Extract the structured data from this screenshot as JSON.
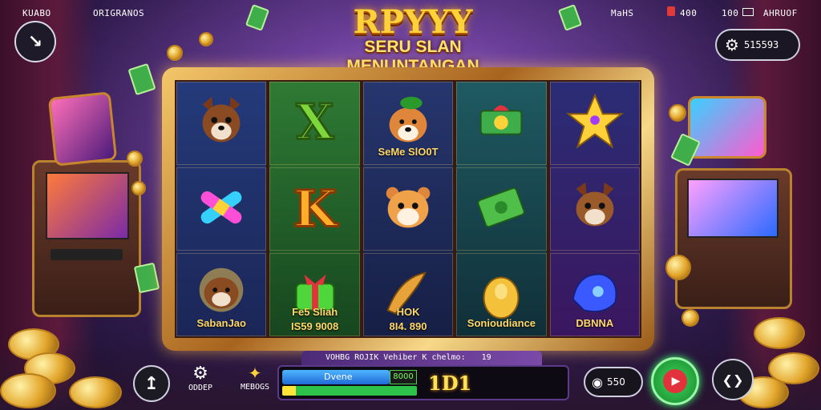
{
  "top": {
    "left_label_1": "KUABO",
    "left_label_2": "ORIGRANOS",
    "right_status_1": "MaHS",
    "right_status_2": "400",
    "right_status_3": "100",
    "right_status_4": "AHRUOF",
    "settings_value": "515593"
  },
  "logo": {
    "title": "RPYYY",
    "subtitle": "SERU SLAN MENUNTANGAN"
  },
  "reels": [
    [
      {
        "icon": "dog-icon",
        "caption": ""
      },
      {
        "icon": "bandage-icon",
        "caption": ""
      },
      {
        "icon": "puppy-icon",
        "caption": "SabanJao"
      }
    ],
    [
      {
        "icon": "letter-x-icon",
        "caption": ""
      },
      {
        "icon": "letter-k-icon",
        "caption": ""
      },
      {
        "icon": "gift-box-icon",
        "caption": "Fe5 Sliah",
        "caption2": "IS59 9008"
      }
    ],
    [
      {
        "icon": "dog-hat-icon",
        "caption": "SeMe SlO0T"
      },
      {
        "icon": "hamster-icon",
        "caption": ""
      },
      {
        "icon": "horn-icon",
        "caption": "HOK",
        "caption2": "8I4. 890"
      }
    ],
    [
      {
        "icon": "money-stack-icon",
        "caption": ""
      },
      {
        "icon": "cash-note-icon",
        "caption": ""
      },
      {
        "icon": "gold-bag-icon",
        "caption": "Sonioudiance"
      }
    ],
    [
      {
        "icon": "crown-icon",
        "caption": ""
      },
      {
        "icon": "dog-paws-icon",
        "caption": ""
      },
      {
        "icon": "blue-shell-icon",
        "caption": "DBNNA"
      }
    ]
  ],
  "panel": {
    "info_text": "VOHBG ROJIK Vehiber K chelmo:",
    "info_count": "19",
    "blue_label": "Dvene",
    "green_value": "8000",
    "digits": "1D1",
    "progress": 1.0
  },
  "controls": {
    "oddep_label": "ODDEP",
    "mebogs_label": "MEBOGS",
    "bet_value": "550"
  },
  "colors": {
    "gold": "#ffd23a",
    "spin_green": "#2ec24b",
    "spin_red": "#e2323c"
  }
}
